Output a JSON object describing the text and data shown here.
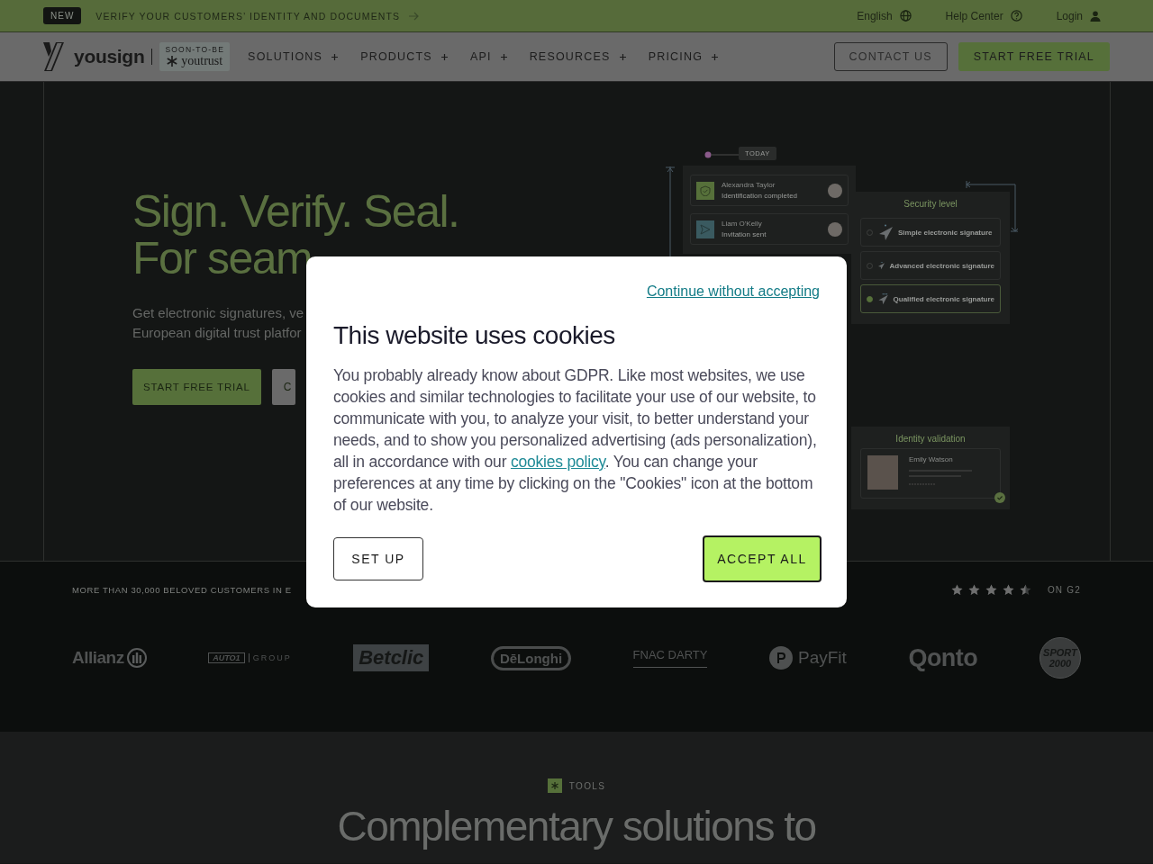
{
  "announcement": {
    "badge": "NEW",
    "text": "VERIFY YOUR CUSTOMERS’ IDENTITY AND DOCUMENTS"
  },
  "utility_links": [
    {
      "label": "English",
      "kind": "language"
    },
    {
      "label": "Help Center",
      "kind": "help"
    },
    {
      "label": "Login",
      "kind": "account"
    }
  ],
  "brand": {
    "name": "yousign",
    "tag_top": "SOON-TO-BE",
    "tag_name": "youtrust"
  },
  "nav": [
    {
      "label": "SOLUTIONS"
    },
    {
      "label": "PRODUCTS"
    },
    {
      "label": "API"
    },
    {
      "label": "RESOURCES"
    },
    {
      "label": "PRICING"
    }
  ],
  "header_buttons": [
    {
      "label": "CONTACT US",
      "kind": "outline"
    },
    {
      "label": "START FREE TRIAL",
      "kind": "primary"
    }
  ],
  "hero": {
    "title_lines": [
      "Sign. Verify. Seal.",
      "For seam"
    ],
    "subtitle_lines": [
      "Get electronic signatures, ve",
      "European digital trust platfor"
    ],
    "buttons": [
      {
        "label": "START FREE TRIAL",
        "kind": "primary"
      },
      {
        "label": "C",
        "kind": "secondary"
      }
    ]
  },
  "diagram": {
    "timeline_badge": "TODAY",
    "activity": [
      {
        "name": "Alexandra Taylor",
        "status": "Identification completed",
        "kind": "verified"
      },
      {
        "name": "Liam O'Kelly",
        "status": "Invitation sent",
        "kind": "sent"
      }
    ],
    "security": {
      "title": "Security level",
      "options": [
        {
          "label": "Simple electronic signature",
          "selected": false
        },
        {
          "label": "Advanced electronic signature",
          "selected": false
        },
        {
          "label": "Qualified electronic signature",
          "selected": true
        }
      ]
    },
    "identity": {
      "title": "Identity validation",
      "name": "Emily Watson"
    }
  },
  "customers": {
    "caption": "MORE THAN 30,000 BELOVED CUSTOMERS IN E",
    "stars": 4.5,
    "rating_source": "ON G2",
    "logos": [
      {
        "text": "Allianz",
        "kind": "allianz"
      },
      {
        "text": "AUTO1",
        "text2": "GROUP",
        "kind": "auto1"
      },
      {
        "text": "Betclic",
        "kind": "betclic"
      },
      {
        "text": "DēLonghi",
        "kind": "delonghi"
      },
      {
        "text": "FNAC DARTY",
        "kind": "fnac"
      },
      {
        "text": "PayFit",
        "kind": "payfit"
      },
      {
        "text": "Qonto",
        "kind": "qonto"
      },
      {
        "text": "SPORT",
        "text2": "2000",
        "kind": "sport"
      }
    ]
  },
  "tools": {
    "badge": "TOOLS",
    "heading": "Complementary solutions to"
  },
  "cookie_dialog": {
    "skip_link": "Continue without accepting",
    "title": "This website uses cookies",
    "body_before": "You probably already know about GDPR. Like most websites, we use cookies and similar technologies to facilitate your use of our website, to communicate with you, to analyze your visit, to better understand your needs, and to show you personalized advertising (ads personalization), all in accordance with our ",
    "policy_link": "cookies policy",
    "body_after": ". You can change your preferences at any time by clicking on the \"Cookies\" icon at the bottom of our website.",
    "buttons": [
      {
        "label": "SET UP",
        "kind": "outline"
      },
      {
        "label": "ACCEPT ALL",
        "kind": "primary"
      }
    ]
  }
}
